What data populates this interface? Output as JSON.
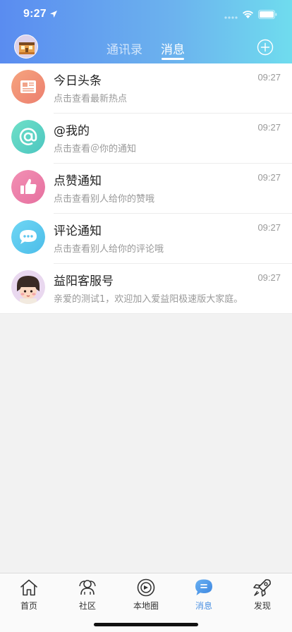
{
  "status_bar": {
    "time": "9:27"
  },
  "header": {
    "tabs": [
      {
        "label": "通讯录",
        "active": false
      },
      {
        "label": "消息",
        "active": true
      }
    ],
    "add_icon": "plus-circle-icon"
  },
  "messages": [
    {
      "title": "今日头条",
      "subtitle": "点击查看最新热点",
      "time": "09:27",
      "icon": "newspaper-icon",
      "color": "#f0937a"
    },
    {
      "title": "@我的",
      "subtitle": "点击查看＠你的通知",
      "time": "09:27",
      "icon": "at-icon",
      "color": "#5fd4c2"
    },
    {
      "title": "点赞通知",
      "subtitle": "点击查看别人给你的赞哦",
      "time": "09:27",
      "icon": "thumbs-up-icon",
      "color": "#ec7fa9"
    },
    {
      "title": "评论通知",
      "subtitle": "点击查看别人给你的评论哦",
      "time": "09:27",
      "icon": "comment-icon",
      "color": "#5ccaf0"
    },
    {
      "title": "益阳客服号",
      "subtitle": "亲爱的测试1，欢迎加入爱益阳极速版大家庭。",
      "time": "09:27",
      "icon": "avatar-cartoon",
      "color": "#e9d8ef"
    }
  ],
  "tabbar": {
    "items": [
      {
        "label": "首页",
        "icon": "home-icon",
        "active": false
      },
      {
        "label": "社区",
        "icon": "community-icon",
        "active": false
      },
      {
        "label": "本地圈",
        "icon": "local-circle-icon",
        "active": false
      },
      {
        "label": "消息",
        "icon": "message-icon",
        "active": true
      },
      {
        "label": "发现",
        "icon": "rocket-icon",
        "active": false
      }
    ],
    "active_color": "#4a90e2"
  }
}
